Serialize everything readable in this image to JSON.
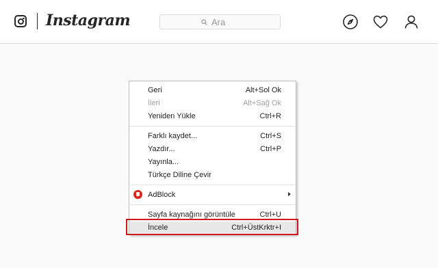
{
  "header": {
    "brand_name": "Instagram",
    "search_placeholder": "Ara",
    "nav_icons": [
      "compass-icon",
      "heart-icon",
      "profile-icon"
    ]
  },
  "context_menu": {
    "items": [
      {
        "label": "Geri",
        "shortcut": "Alt+Sol Ok",
        "enabled": true
      },
      {
        "label": "İleri",
        "shortcut": "Alt+Sağ Ok",
        "enabled": false
      },
      {
        "label": "Yeniden Yükle",
        "shortcut": "Ctrl+R",
        "enabled": true
      },
      {
        "label": "Farklı kaydet...",
        "shortcut": "Ctrl+S",
        "enabled": true
      },
      {
        "label": "Yazdır...",
        "shortcut": "Ctrl+P",
        "enabled": true
      },
      {
        "label": "Yayınla...",
        "shortcut": "",
        "enabled": true
      },
      {
        "label": "Türkçe Diline Çevir",
        "shortcut": "",
        "enabled": true
      },
      {
        "label": "AdBlock",
        "shortcut": "",
        "enabled": true,
        "icon": "adblock-icon",
        "has_submenu": true
      },
      {
        "label": "Sayfa kaynağını görüntüle",
        "shortcut": "Ctrl+U",
        "enabled": true
      },
      {
        "label": "İncele",
        "shortcut": "Ctrl+ÜstKrktr+I",
        "enabled": true,
        "highlighted": true
      }
    ]
  },
  "colors": {
    "highlight_border": "#d0161e",
    "adblock_red": "#d8281e",
    "disabled_text": "#a0a0a0",
    "header_background": "#ffffff",
    "page_background": "#fafafa"
  }
}
